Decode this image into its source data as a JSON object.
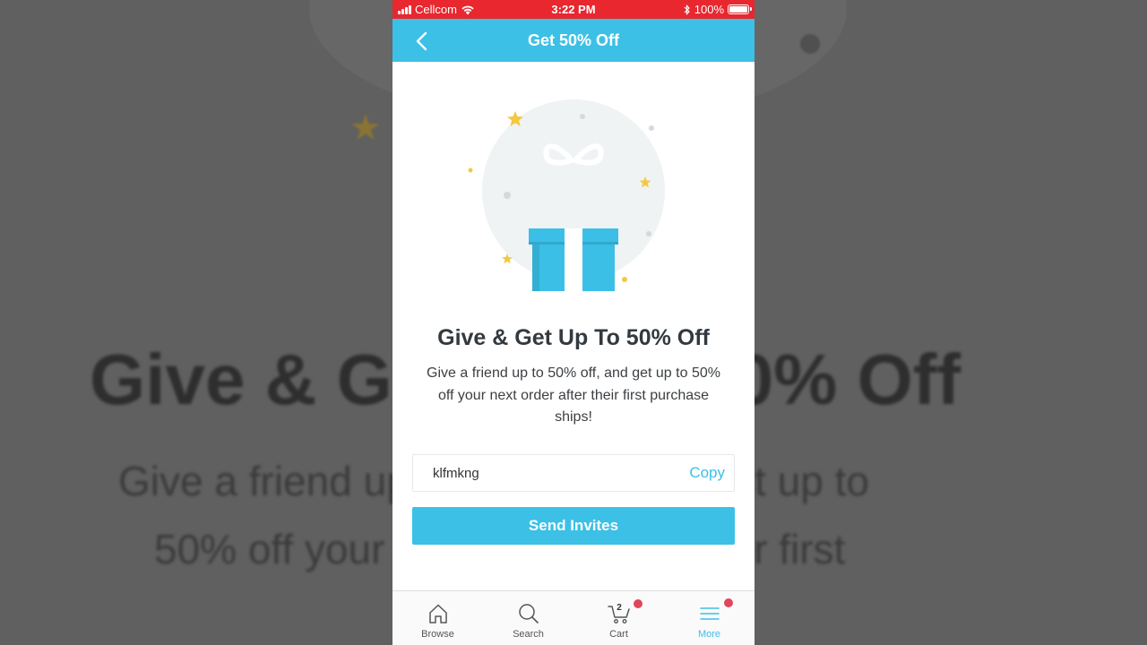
{
  "status_bar": {
    "carrier": "Cellcom",
    "time": "3:22 PM",
    "battery": "100%"
  },
  "nav": {
    "title": "Get 50% Off",
    "back_icon": "chevron-left-icon"
  },
  "promo": {
    "headline": "Give & Get Up To 50% Off",
    "description": "Give a friend up to 50% off, and get up to 50% off your next order after their first purchase ships!"
  },
  "invite": {
    "code": "klfmkng",
    "copy_label": "Copy",
    "send_label": "Send Invites"
  },
  "tabbar": {
    "items": [
      {
        "label": "Browse",
        "icon": "home-icon"
      },
      {
        "label": "Search",
        "icon": "search-icon"
      },
      {
        "label": "Cart",
        "icon": "cart-icon",
        "count": "2"
      },
      {
        "label": "More",
        "icon": "menu-icon"
      }
    ]
  },
  "background": {
    "title": "Give & Get Up To 50% Off",
    "line1": "Give a friend up to 50% off, and get up to",
    "line2": "50% off your next order after their first"
  },
  "colors": {
    "accent": "#3cc0e6",
    "status_bar": "#e8272f",
    "badge": "#e0475a"
  }
}
